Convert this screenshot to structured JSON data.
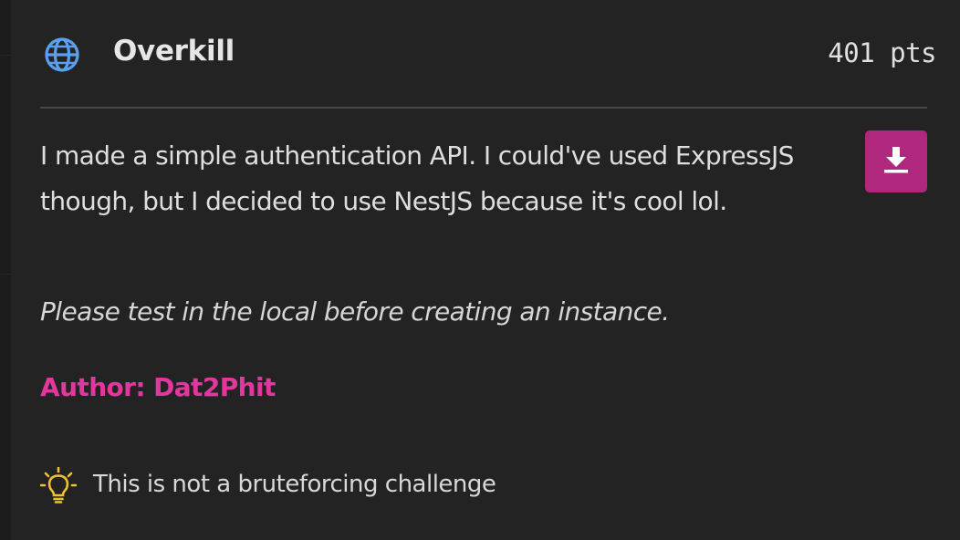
{
  "challenge": {
    "title": "Overkill",
    "points": "401 pts",
    "category_icon": "globe-icon",
    "description": "I made a simple authentication API. I could've used ExpressJS though, but I decided to use NestJS because it's cool lol.",
    "note": "Please test in the local before creating an instance.",
    "author": "Author: Dat2Phit",
    "download_icon": "download-icon",
    "hint": {
      "icon": "lightbulb-icon",
      "text": "This is not a bruteforcing challenge"
    }
  },
  "colors": {
    "modal_bg": "#232323",
    "accent_pink": "#e2379d",
    "download_bg": "#b0287e",
    "globe_blue": "#5aa0f2",
    "bulb_yellow": "#f0c030"
  }
}
